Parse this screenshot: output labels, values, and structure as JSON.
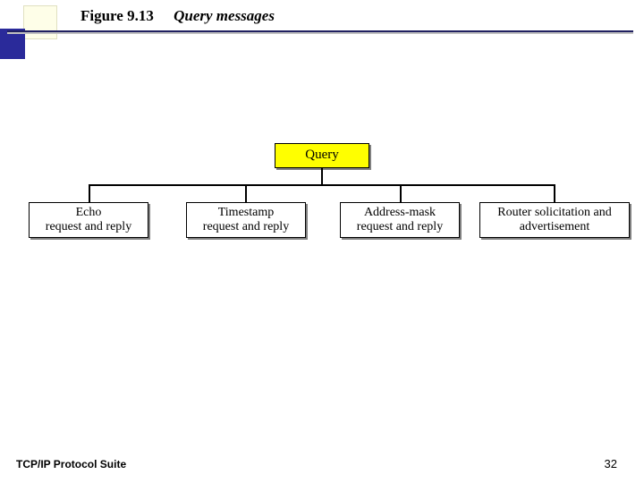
{
  "header": {
    "figure_number": "Figure 9.13",
    "figure_title": "Query messages"
  },
  "diagram": {
    "root_label": "Query",
    "colors": {
      "root_bg": "#ffff00"
    },
    "leaves": [
      "Echo\nrequest and reply",
      "Timestamp\nrequest and reply",
      "Address-mask\nrequest and reply",
      "Router solicitation and\nadvertisement"
    ]
  },
  "footer": {
    "left": "TCP/IP Protocol Suite",
    "page_number": "32"
  }
}
